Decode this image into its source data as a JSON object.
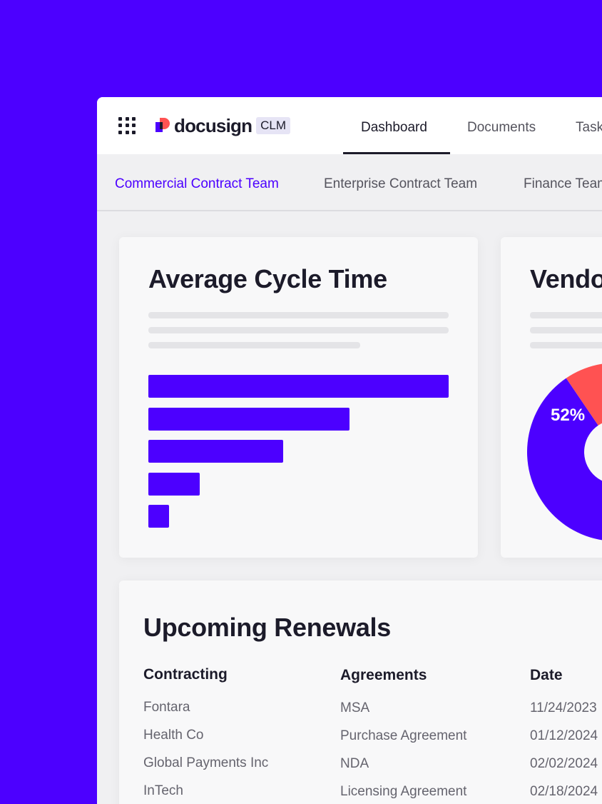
{
  "brand": {
    "logo_text": "docusign",
    "product_badge": "CLM",
    "accent_color": "#4c00ff",
    "logo_colors": [
      "#ff5252",
      "#4c00ff",
      "#1c1b2a"
    ]
  },
  "topnav": {
    "apps_icon": "grid-icon",
    "tabs": [
      {
        "label": "Dashboard",
        "active": true
      },
      {
        "label": "Documents",
        "active": false
      },
      {
        "label": "Tasks",
        "active": false
      }
    ]
  },
  "subnav": {
    "tabs": [
      {
        "label": "Commercial Contract Team",
        "active": true
      },
      {
        "label": "Enterprise Contract Team",
        "active": false
      },
      {
        "label": "Finance Team",
        "active": false
      }
    ]
  },
  "cycle_card": {
    "title": "Average Cycle Time",
    "chart_data": {
      "type": "bar",
      "orientation": "horizontal",
      "values": [
        100,
        67,
        45,
        17,
        7
      ],
      "color": "#4c00ff"
    }
  },
  "vendor_card": {
    "title": "Vendor",
    "chart_data": {
      "type": "pie",
      "style": "donut",
      "slices": [
        {
          "value": 52,
          "label": "52%",
          "color": "#4c00ff"
        },
        {
          "value": 48,
          "color": "#ff5252"
        }
      ]
    }
  },
  "renewals": {
    "title": "Upcoming Renewals",
    "columns": [
      "Contracting",
      "Agreements",
      "Date"
    ],
    "rows": [
      [
        "Fontara",
        "MSA",
        "11/24/2023"
      ],
      [
        "Health Co",
        "Purchase Agreement",
        "01/12/2024"
      ],
      [
        "Global Payments Inc",
        "NDA",
        "02/02/2024"
      ],
      [
        "InTech",
        "Licensing Agreement",
        "02/18/2024"
      ]
    ]
  }
}
